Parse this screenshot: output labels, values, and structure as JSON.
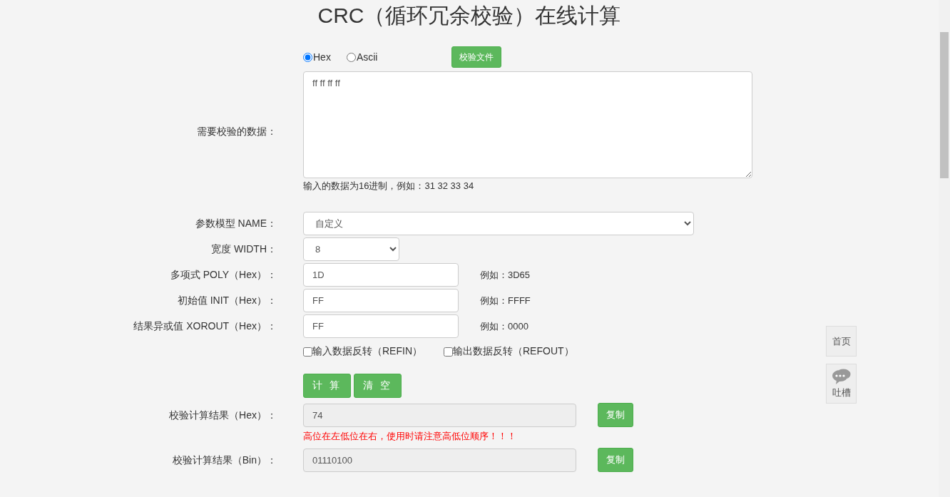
{
  "title": "CRC（循环冗余校验）在线计算",
  "data_format": [
    {
      "label": "Hex",
      "selected": true
    },
    {
      "label": "Ascii",
      "selected": false
    }
  ],
  "file_button": "校验文件",
  "data_input": {
    "label": "需要校验的数据：",
    "value": "ff ff ff ff"
  },
  "data_hint": "输入的数据为16进制，例如：31 32 33 34",
  "params": [
    {
      "kind": "wide_select",
      "label": "参数模型 NAME：",
      "value": "自定义"
    },
    {
      "kind": "narrow_select",
      "label": "宽度 WIDTH：",
      "value": "8"
    },
    {
      "kind": "input",
      "label": "多项式 POLY（Hex）：",
      "value": "1D",
      "example": "例如：3D65"
    },
    {
      "kind": "input",
      "label": "初始值 INIT（Hex）：",
      "value": "FF",
      "example": "例如：FFFF"
    },
    {
      "kind": "input",
      "label": "结果异或值 XOROUT（Hex）：",
      "value": "FF",
      "example": "例如：0000"
    }
  ],
  "options": [
    {
      "label": "输入数据反转（REFIN）",
      "checked": false
    },
    {
      "label": "输出数据反转（REFOUT）",
      "checked": false
    }
  ],
  "actions": [
    "计 算",
    "清 空"
  ],
  "results": [
    {
      "label": "校验计算结果（Hex）：",
      "value": "74",
      "copy_button": "复制",
      "note": "高位在左低位在右，使用时请注意高低位顺序！！！"
    },
    {
      "label": "校验计算结果（Bin）：",
      "value": "01110100",
      "copy_button": "复制"
    }
  ],
  "side_buttons": [
    {
      "kind": "text",
      "label": "首页"
    },
    {
      "kind": "chat",
      "label": "吐槽"
    }
  ]
}
